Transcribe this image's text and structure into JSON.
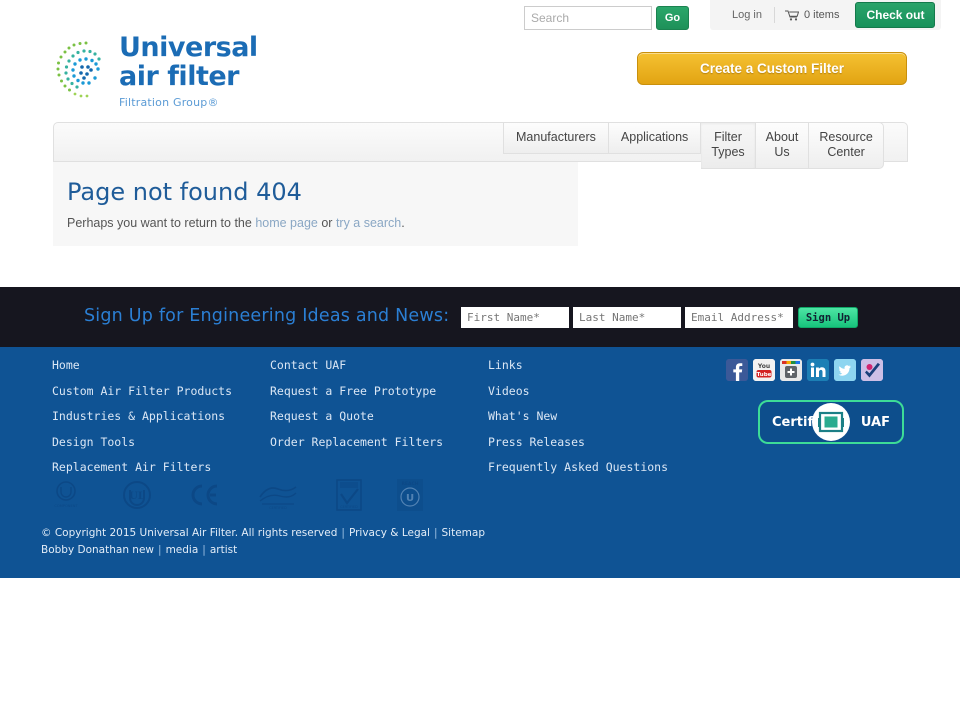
{
  "utility": {
    "search_placeholder": "Search",
    "search_value": "",
    "go_label": "Go",
    "login_label": "Log in",
    "cart_label": "0 items",
    "checkout_label": "Check out"
  },
  "logo": {
    "line1": "Universal",
    "line2": "air filter",
    "sub": "Filtration Group®"
  },
  "cta": {
    "label": "Create a Custom Filter"
  },
  "nav": {
    "items": [
      {
        "label": "Manufacturers",
        "line1": "Manufacturers",
        "line2": "",
        "active": false
      },
      {
        "label": "Applications",
        "line1": "Applications",
        "line2": "",
        "active": false
      },
      {
        "label": "Filter Types",
        "line1": "Filter",
        "line2": "Types",
        "active": true
      },
      {
        "label": "About Us",
        "line1": "About",
        "line2": "Us",
        "active": false
      },
      {
        "label": "Resource Center",
        "line1": "Resource",
        "line2": "Center",
        "active": false
      }
    ]
  },
  "content": {
    "title": "Page not found 404",
    "text_before": "Perhaps you want to return to the ",
    "link_home": "home page",
    "text_middle": " or ",
    "link_search": "try a search",
    "text_after": "."
  },
  "signup": {
    "heading": "Sign Up for Engineering Ideas and News:",
    "first_placeholder": "First Name*",
    "last_placeholder": "Last Name*",
    "email_placeholder": "Email Address*",
    "first_value": "",
    "last_value": "",
    "email_value": "",
    "button_label": "Sign Up"
  },
  "footer": {
    "columns": [
      {
        "links": [
          "Home",
          "Custom Air Filter Products",
          "Industries & Applications",
          "Design Tools",
          "Replacement Air Filters"
        ]
      },
      {
        "links": [
          "Contact UAF",
          "Request a Free Prototype",
          "Request a Quote",
          "Order Replacement Filters"
        ]
      },
      {
        "links": [
          "Links",
          "Videos",
          "What's New",
          "Press Releases",
          "Frequently Asked Questions"
        ]
      }
    ],
    "social": [
      {
        "name": "facebook-icon",
        "glyph": "f",
        "color": "#3b5998"
      },
      {
        "name": "youtube-icon",
        "glyph": "You",
        "color": "#ffffff"
      },
      {
        "name": "googleplus-icon",
        "glyph": "+",
        "color": "#dddddd"
      },
      {
        "name": "linkedin-icon",
        "glyph": "in",
        "color": "#0e76a8"
      },
      {
        "name": "twitter-icon",
        "glyph": "t",
        "color": "#5bc3e8"
      },
      {
        "name": "check-icon",
        "glyph": "✓",
        "color": "#b8a7d9"
      }
    ],
    "badge": {
      "left": "Certified",
      "right": "UAF"
    },
    "certifications": [
      "ul-recognized-icon",
      "ul-listed-icon",
      "ce-mark-icon",
      "wave-seal-icon",
      "checkmark-seal-icon",
      "reach-icon"
    ],
    "copyright": "© Copyright 2015 Universal Air Filter. All rights reserved",
    "privacy": "Privacy & Legal",
    "sitemap": "Sitemap",
    "credit_name": "Bobby Donathan new",
    "credit_media": "media",
    "credit_artist": "artist"
  },
  "colors": {
    "brand_blue": "#0f5394",
    "logo_blue": "#1b6cb5",
    "accent_green": "#17915a",
    "cta_gold": "#e2a413",
    "signup_dark": "#16161f",
    "signup_text": "#2b7fd4",
    "badge_green": "#3ddc97"
  }
}
